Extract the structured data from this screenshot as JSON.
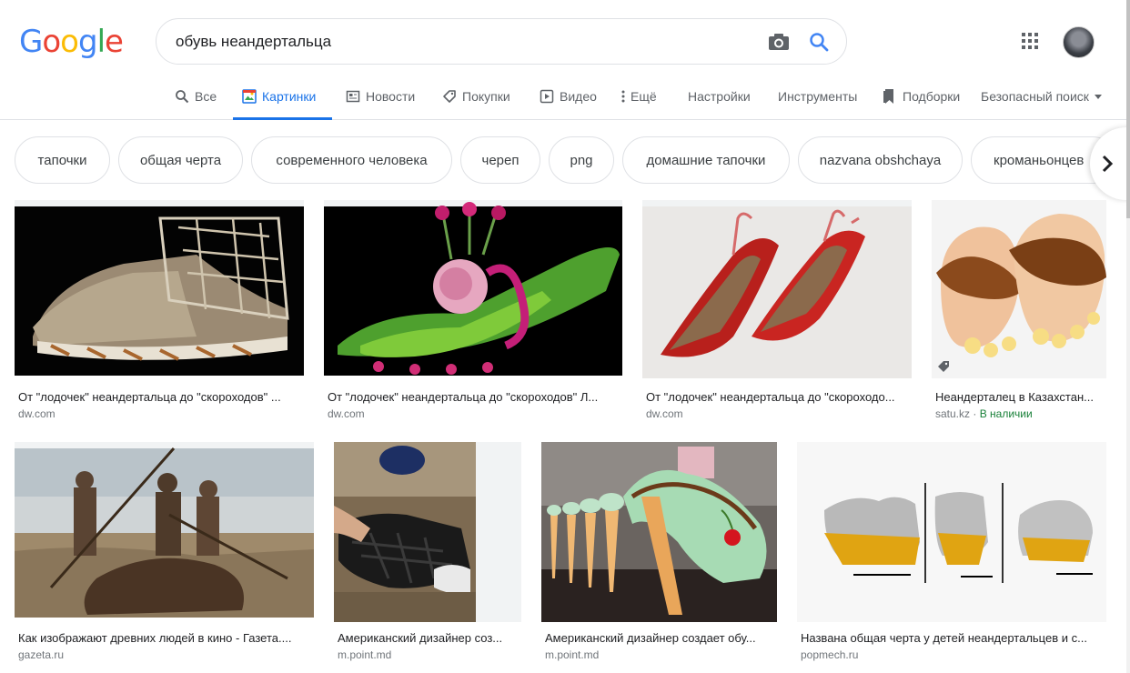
{
  "logo": {
    "g1": "G",
    "o1": "o",
    "o2": "o",
    "g2": "g",
    "l": "l",
    "e": "e"
  },
  "search": {
    "query": "обувь неандертальца"
  },
  "tabs": [
    {
      "label": "Все",
      "icon": "search-icon"
    },
    {
      "label": "Картинки",
      "icon": "image-icon",
      "active": true
    },
    {
      "label": "Новости",
      "icon": "news-icon"
    },
    {
      "label": "Покупки",
      "icon": "tag-icon"
    },
    {
      "label": "Видео",
      "icon": "play-icon"
    },
    {
      "label": "Ещё",
      "icon": "more-vert-icon"
    },
    {
      "label": "Настройки"
    },
    {
      "label": "Инструменты"
    },
    {
      "label": "Подборки",
      "icon": "bookmark-icon"
    },
    {
      "label": "Безопасный поиск",
      "icon": "dropdown-icon"
    }
  ],
  "chips": [
    "тапочки",
    "общая черта",
    "современного человека",
    "череп",
    "png",
    "домашние тапочки",
    "nazvana obshchaya",
    "кроманьонцев"
  ],
  "results": [
    {
      "title": "От \"лодочек\" неандертальца до \"скороходов\" ...",
      "source": "dw.com"
    },
    {
      "title": "От \"лодочек\" неандертальца до \"скороходов\" Л...",
      "source": "dw.com"
    },
    {
      "title": "От \"лодочек\" неандертальца до \"скороходо...",
      "source": "dw.com"
    },
    {
      "title": "Неандерталец в Казахстан...",
      "source": "satu.kz",
      "sep": " · ",
      "stock": "В наличии"
    },
    {
      "title": "Как изображают древних людей в кино - Газета....",
      "source": "gazeta.ru"
    },
    {
      "title": "Американский дизайнер соз...",
      "source": "m.point.md"
    },
    {
      "title": "Американский дизайнер создает обу...",
      "source": "m.point.md"
    },
    {
      "title": "Названа общая черта у детей неандертальцев и с...",
      "source": "popmech.ru"
    }
  ],
  "colors": {
    "accent": "#1a73e8",
    "text": "#202124",
    "muted": "#70757a",
    "stock": "#188038"
  }
}
